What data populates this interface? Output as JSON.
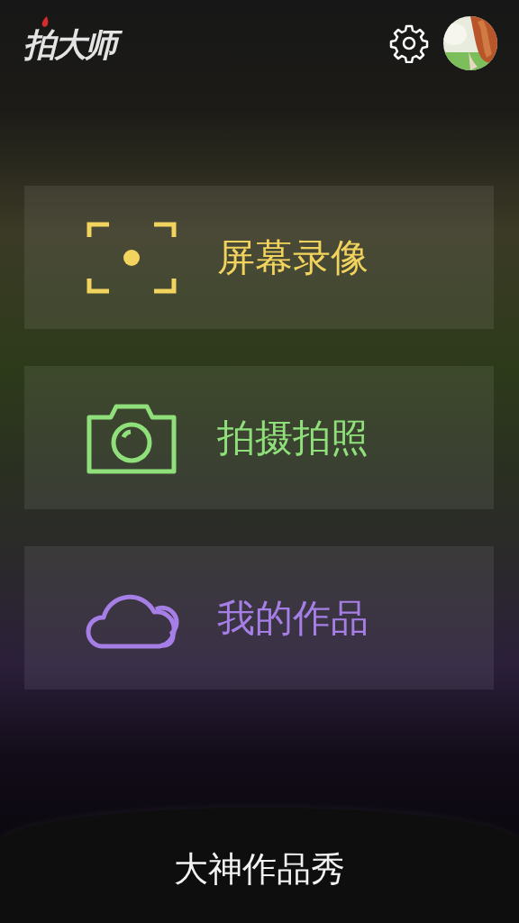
{
  "header": {
    "logo": "拍大师"
  },
  "menu": [
    {
      "kind": "record",
      "label": "屏幕录像",
      "color": "#f2d35e"
    },
    {
      "kind": "camera",
      "label": "拍摄拍照",
      "color": "#8fe07a"
    },
    {
      "kind": "cloud",
      "label": "我的作品",
      "color": "#a57ee6"
    }
  ],
  "footer": {
    "label": "大神作品秀"
  }
}
